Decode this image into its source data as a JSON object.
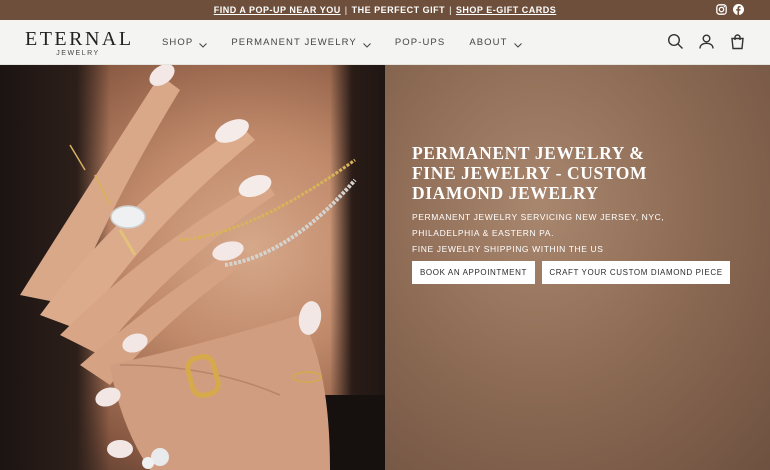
{
  "announcement": {
    "link1": "FIND A POP-UP NEAR YOU",
    "sep1": "|",
    "text2": "THE PERFECT GIFT",
    "sep2": "|",
    "link3": "SHOP E-GIFT CARDS",
    "social": [
      "instagram-icon",
      "facebook-icon"
    ]
  },
  "header": {
    "logo_main": "ETERNAL",
    "logo_sub": "JEWELRY",
    "nav": [
      {
        "label": "SHOP",
        "dropdown": true
      },
      {
        "label": "PERMANENT JEWELRY",
        "dropdown": true
      },
      {
        "label": "POP-UPS",
        "dropdown": false
      },
      {
        "label": "ABOUT",
        "dropdown": true
      }
    ],
    "icons": [
      "search-icon",
      "account-icon",
      "cart-icon"
    ]
  },
  "hero": {
    "headline": "PERMANENT JEWELRY & FINE JEWELRY - CUSTOM DIAMOND JEWELRY",
    "sub1": "PERMANENT JEWELRY SERVICING NEW JERSEY, NYC,",
    "sub2": "PHILADELPHIA & EASTERN PA.",
    "sub3": "FINE JEWELRY SHIPPING WITHIN THE US",
    "button1": "BOOK AN APPOINTMENT",
    "button2": "CRAFT YOUR CUSTOM DIAMOND PIECE"
  },
  "colors": {
    "announcement_bg": "#6e4f3c",
    "header_bg": "#f4f4f3",
    "hero_brown": "#8e6c55"
  }
}
